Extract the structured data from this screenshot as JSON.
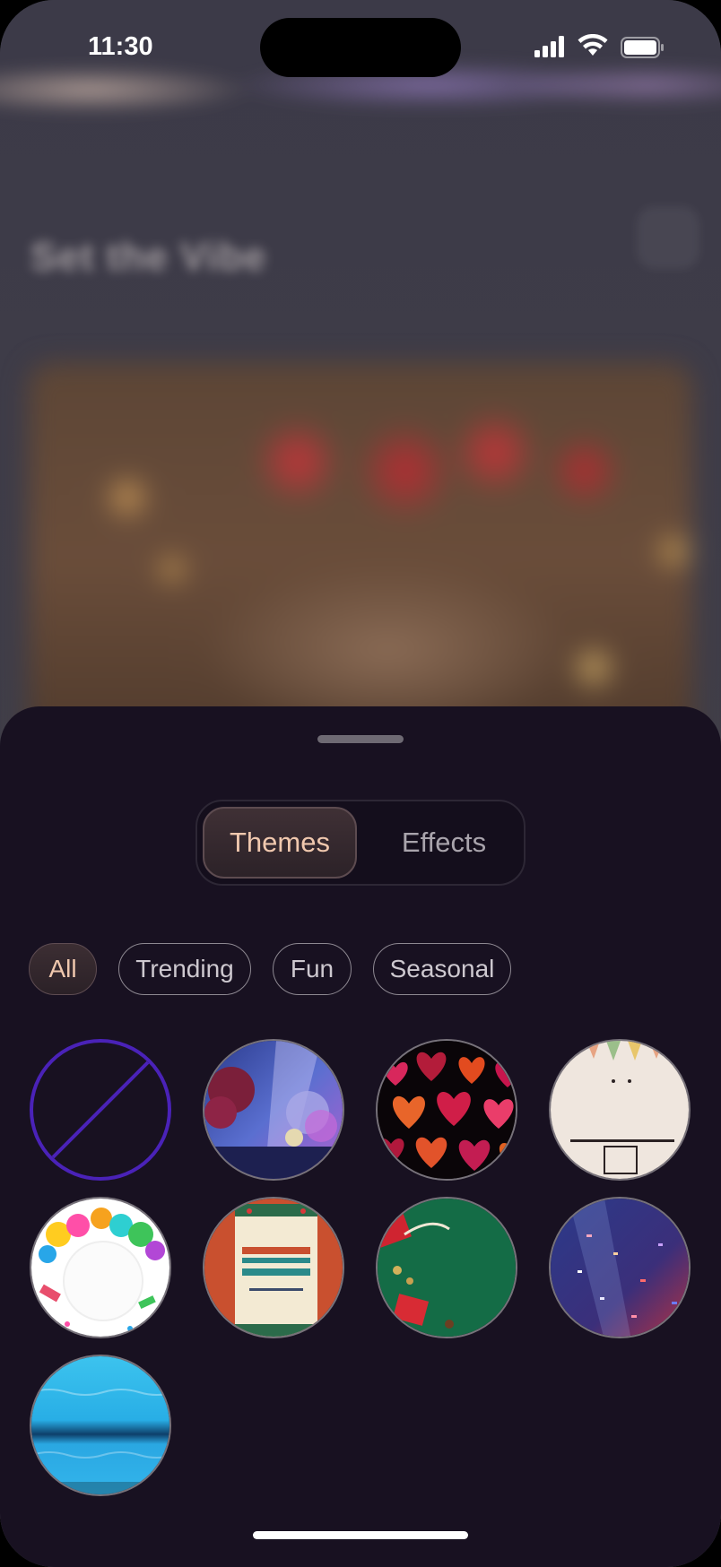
{
  "status_bar": {
    "time": "11:30"
  },
  "background": {
    "title": "Set the Vibe"
  },
  "tabs": {
    "themes_label": "Themes",
    "effects_label": "Effects",
    "selected": "Themes"
  },
  "filters": [
    {
      "label": "All",
      "selected": true
    },
    {
      "label": "Trending",
      "selected": false
    },
    {
      "label": "Fun",
      "selected": false
    },
    {
      "label": "Seasonal",
      "selected": false
    }
  ],
  "themes": [
    {
      "name": "none",
      "kind": "none-option"
    },
    {
      "name": "floral-event-lights"
    },
    {
      "name": "red-hearts-pattern"
    },
    {
      "name": "happy-birthday-lettering"
    },
    {
      "name": "balloons-confetti"
    },
    {
      "name": "christmas-big-party-poster"
    },
    {
      "name": "green-christmas-gifts"
    },
    {
      "name": "blue-purple-confetti"
    },
    {
      "name": "blue-water-surface"
    }
  ],
  "colors": {
    "accent": "#f0c8ae",
    "sheet": "#181121",
    "none_ring": "#4a22b8"
  }
}
